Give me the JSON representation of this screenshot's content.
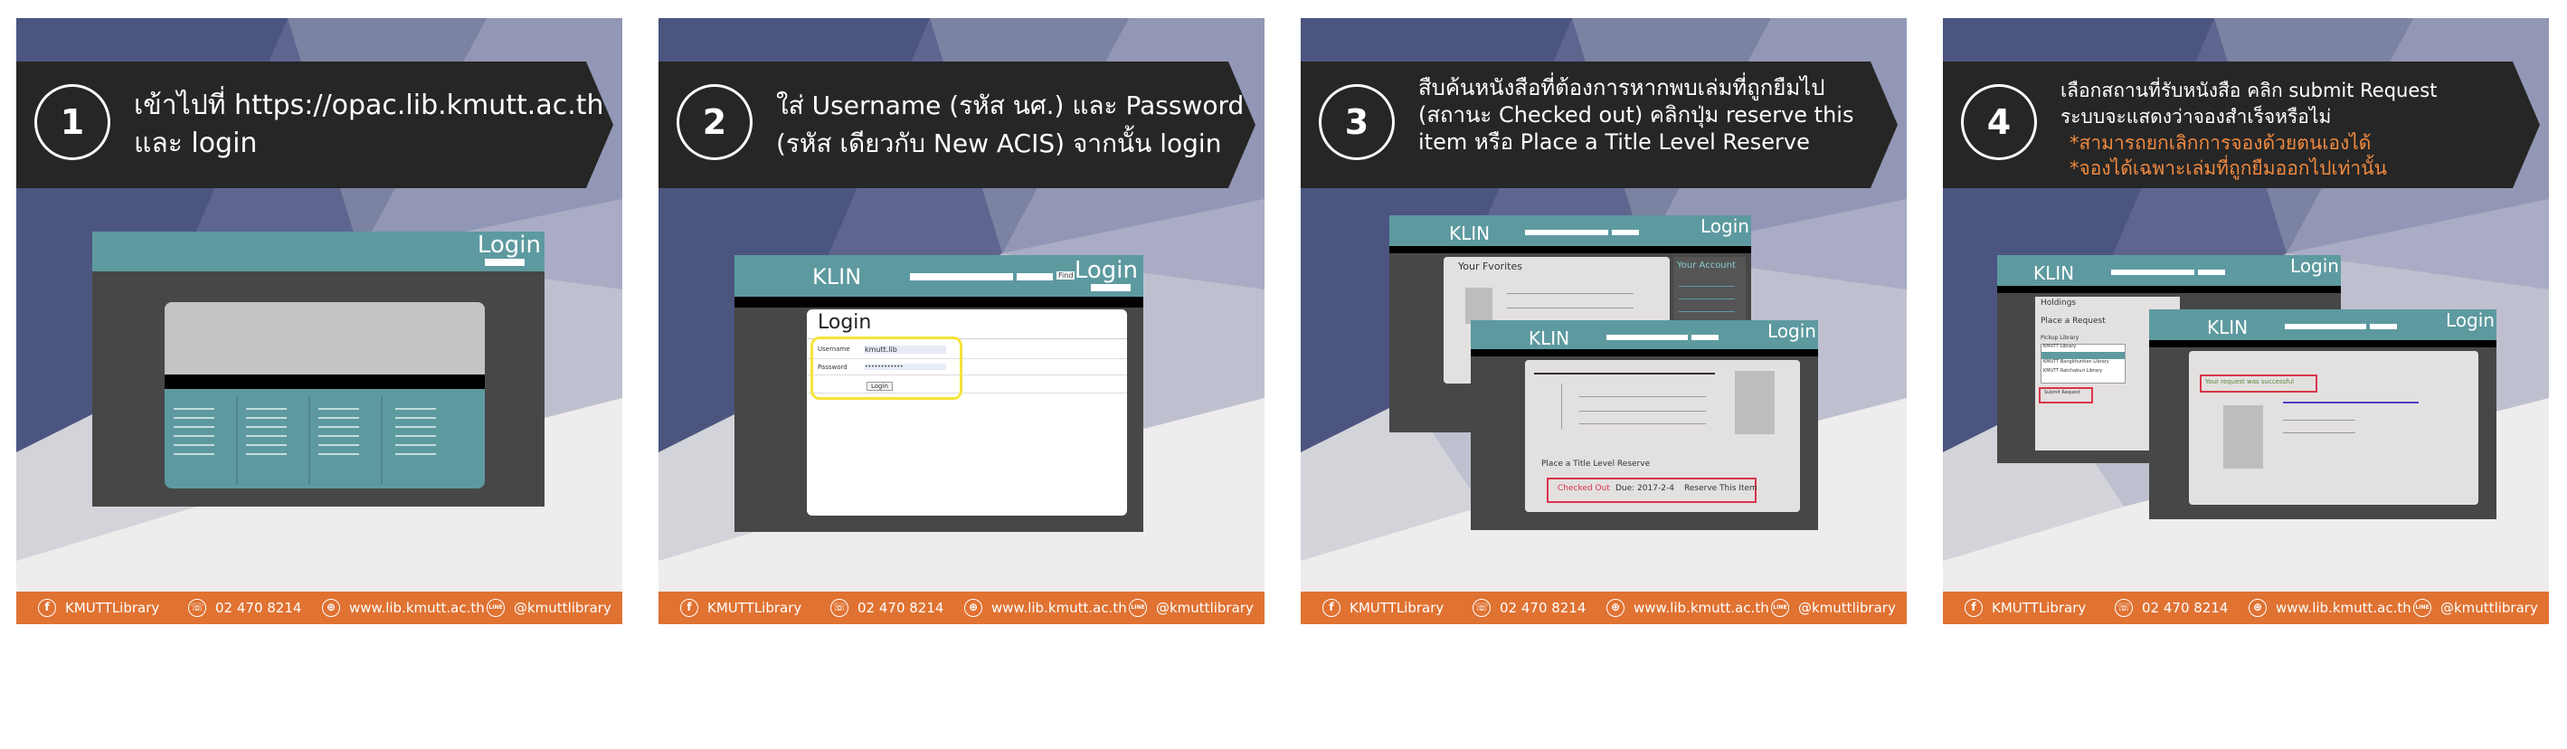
{
  "panels": [
    {
      "number": "1",
      "text_lines": [
        "เข้าไปที่ https://opac.lib.kmutt.ac.th",
        "และ login"
      ],
      "screen": {
        "login_label": "Login"
      }
    },
    {
      "number": "2",
      "text_lines": [
        "ใส่ Username (รหัส นศ.) และ Password",
        "(รหัส เดียวกับ New ACIS) จากนั้น login"
      ],
      "screen": {
        "klin_label": "KLIN",
        "login_label": "Login",
        "find_label": "Find",
        "form_title": "Login",
        "username_label": "Username",
        "username_value": "kmutt.lib",
        "password_label": "Password",
        "password_value": "••••••••••••",
        "login_button": "Login"
      }
    },
    {
      "number": "3",
      "text_lines": [
        "สืบค้นหนังสือที่ต้องการหากพบเล่มที่ถูกยืมไป",
        "(สถานะ Checked out) คลิกปุ่ม reserve this",
        "item หรือ Place a Title Level Reserve"
      ],
      "screen": {
        "klin_label": "KLIN",
        "login_label": "Login",
        "favorites_label": "Your Fvorites",
        "account_label": "Your Account",
        "title_reserve": "Place a Title Level Reserve",
        "checked_out": "Checked Out",
        "due_text": "Due: 2017-2-4",
        "reserve_item": "Reserve This Item"
      }
    },
    {
      "number": "4",
      "text_lines": [
        "เลือกสถานที่รับหนังสือ คลิก submit Request",
        "ระบบจะแสดงว่าจองสำเร็จหรือไม่"
      ],
      "notes": [
        "*สามารถยกเลิกการจองด้วยตนเองได้",
        "*จองได้เฉพาะเล่มที่ถูกยืมออกไปเท่านั้น"
      ],
      "screen": {
        "klin_label": "KLIN",
        "login_label": "Login",
        "holdings": "Holdings",
        "place_request": "Place a Request",
        "pickup_library": "Pickup Library",
        "option1": "KMUTT Library",
        "option2": "KMUTT Bangkhuntien Library",
        "option3": "KMUTT Ratchaburi Library",
        "submit_request": "Submit Request",
        "success_message": "Your request was successful"
      }
    }
  ],
  "footer": {
    "facebook": "KMUTTLibrary",
    "phone": "02 470 8214",
    "website": "www.lib.kmutt.ac.th",
    "line": "@kmuttlibrary",
    "line_icon_label": "LINE"
  },
  "colors": {
    "banner": "#262626",
    "footer": "#e07232",
    "header_teal": "#5d9aa0",
    "note_orange": "#f08a40"
  }
}
